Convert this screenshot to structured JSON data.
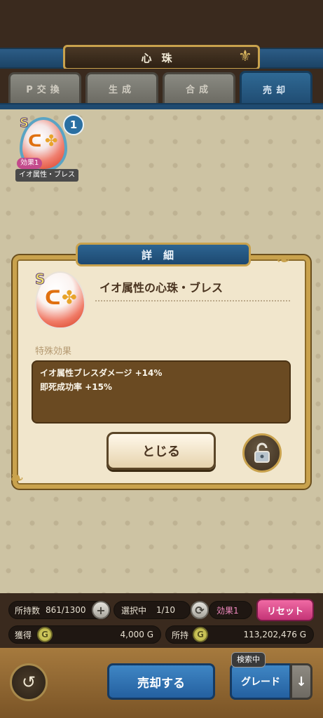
{
  "header": {
    "title": "心珠"
  },
  "tabs": [
    {
      "label": "P交換"
    },
    {
      "label": "生成"
    },
    {
      "label": "合成"
    },
    {
      "label": "売却",
      "active": true
    }
  ],
  "item_card": {
    "rank": "S",
    "count": "1",
    "effect_tag": "効果1",
    "name": "イオ属性・ブレス"
  },
  "dialog": {
    "header": "詳細",
    "rank": "S",
    "title": "イオ属性の心珠・ブレス",
    "section_label": "特殊効果",
    "effects": [
      "イオ属性ブレスダメージ +14%",
      "即死成功率 +15%"
    ],
    "close_label": "とじる"
  },
  "status": {
    "owned_label": "所持数",
    "owned_value": "861/1300",
    "selected_label": "選択中",
    "selected_value": "1/10",
    "effect_filter": "効果1",
    "reset_label": "リセット",
    "gain_label": "獲得",
    "gain_value": "4,000 G",
    "held_label": "所持",
    "held_value": "113,202,476 G"
  },
  "bottom": {
    "sell_label": "売却する",
    "grade_label": "グレード",
    "searching_tag": "検索中"
  },
  "colors": {
    "accent_blue": "#2460a0",
    "gold_frame": "#c9a24d",
    "reset_pink": "#c43476"
  }
}
